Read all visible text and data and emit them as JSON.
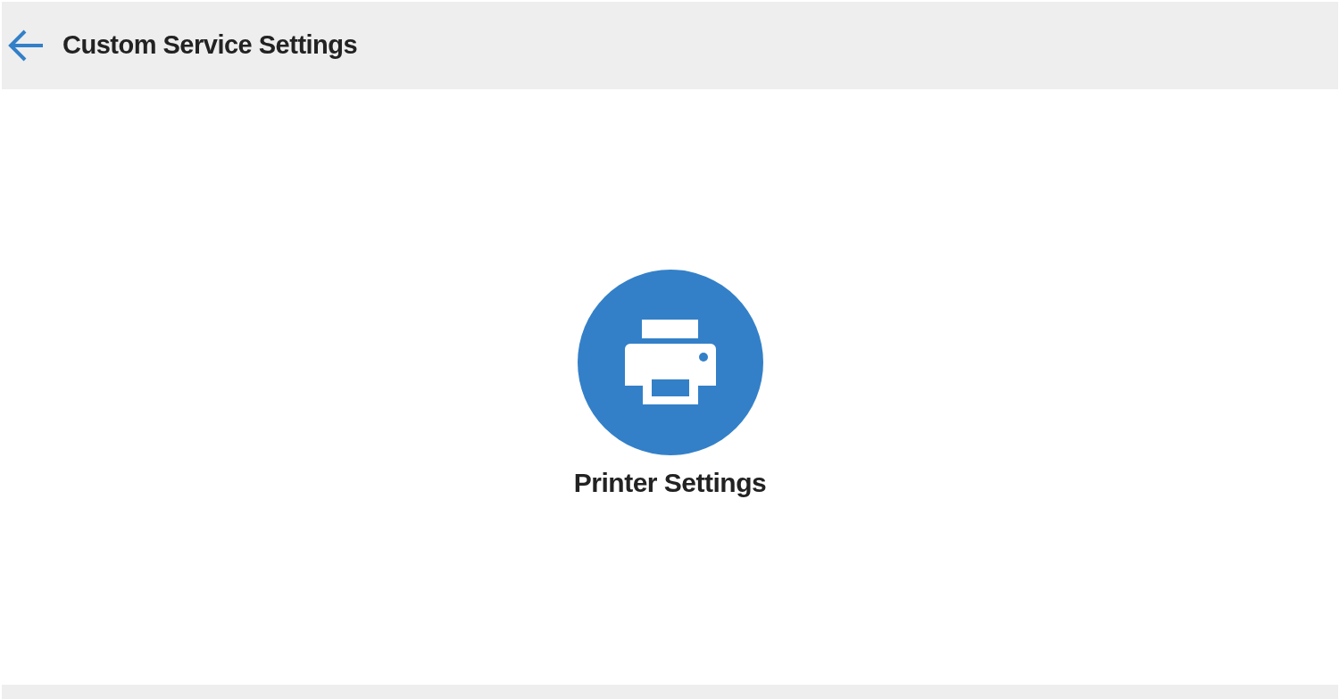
{
  "header": {
    "title": "Custom Service Settings"
  },
  "services": [
    {
      "kind": "printer",
      "label": "Printer Settings"
    }
  ]
}
